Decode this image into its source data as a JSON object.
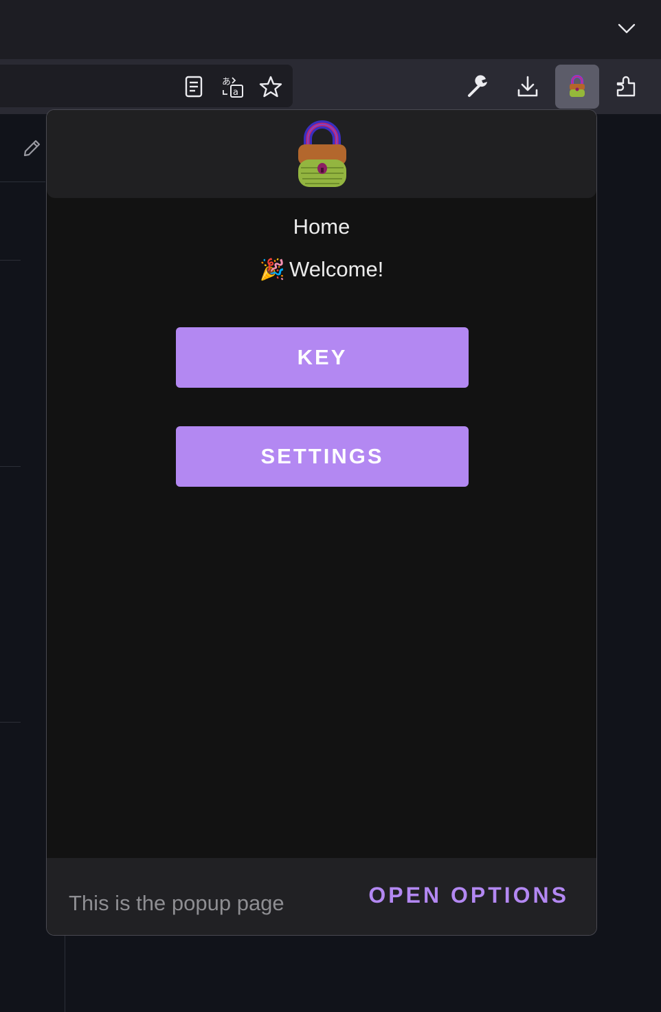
{
  "browser": {
    "icons": {
      "tab_menu": "chevron-down-icon",
      "reader": "reader-mode-icon",
      "translate": "translate-icon",
      "bookmark": "star-icon",
      "devtools": "wrench-icon",
      "downloads": "download-icon",
      "extension_active": "padlock-extension-icon",
      "extensions": "puzzle-icon",
      "edit": "pencil-icon"
    }
  },
  "popup": {
    "title": "Home",
    "welcome_emoji": "🎉",
    "welcome_text": "Welcome!",
    "buttons": {
      "key": "KEY",
      "settings": "SETTINGS"
    },
    "footer": {
      "text": "This is the popup page",
      "link": "OPEN OPTIONS"
    }
  },
  "colors": {
    "accent": "#b388f2",
    "popup_bg": "#121212",
    "header_bg": "#202022",
    "toolbar_bg": "#2a2a33"
  }
}
